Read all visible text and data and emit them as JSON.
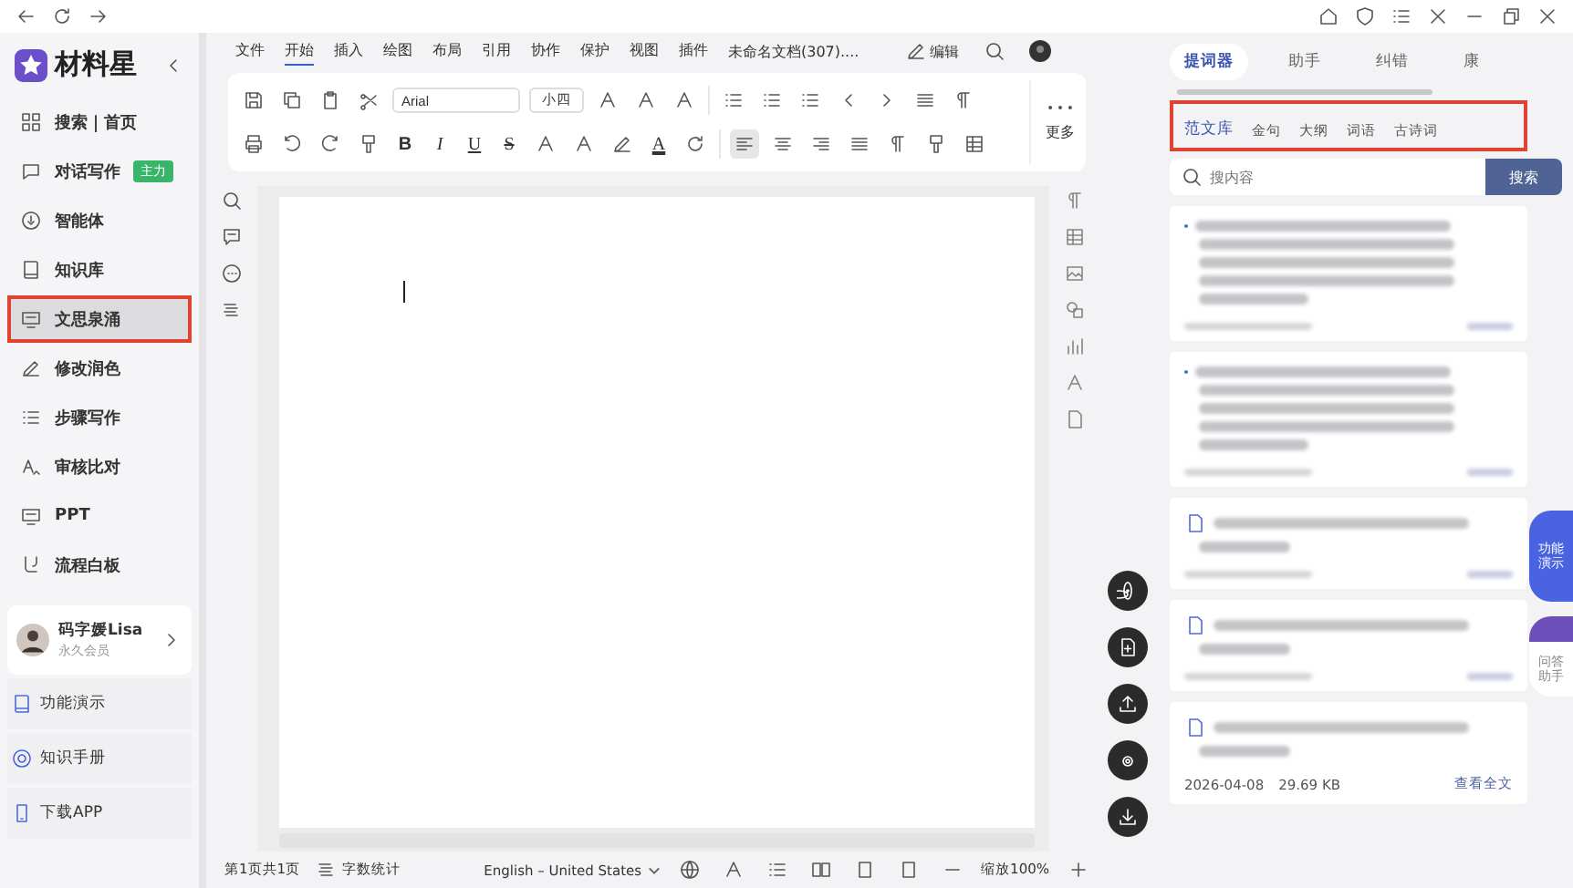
{
  "app": {
    "name": "材料星"
  },
  "sidebar": {
    "items": [
      {
        "label": "搜索｜首页",
        "selected": false,
        "highlighted": false
      },
      {
        "label": "对话写作",
        "badge": "主力",
        "selected": false,
        "highlighted": false
      },
      {
        "label": "智能体",
        "selected": false,
        "highlighted": false
      },
      {
        "label": "知识库",
        "selected": false,
        "highlighted": false
      },
      {
        "label": "文思泉涌",
        "selected": true,
        "highlighted": true
      },
      {
        "label": "修改润色",
        "selected": false,
        "highlighted": false
      },
      {
        "label": "步骤写作",
        "selected": false,
        "highlighted": false
      },
      {
        "label": "审核比对",
        "selected": false,
        "highlighted": false
      },
      {
        "label": "PPT",
        "selected": false,
        "highlighted": false
      },
      {
        "label": "流程白板",
        "selected": false,
        "highlighted": false
      }
    ],
    "user": {
      "name": "码字媛Lisa",
      "level": "永久会员"
    },
    "links": [
      {
        "label": "功能演示"
      },
      {
        "label": "知识手册"
      },
      {
        "label": "下载APP"
      }
    ]
  },
  "menu": {
    "tabs": [
      {
        "label": "文件",
        "selected": false
      },
      {
        "label": "开始",
        "selected": true
      },
      {
        "label": "插入",
        "selected": false
      },
      {
        "label": "绘图",
        "selected": false
      },
      {
        "label": "布局",
        "selected": false
      },
      {
        "label": "引用",
        "selected": false
      },
      {
        "label": "协作",
        "selected": false
      },
      {
        "label": "保护",
        "selected": false
      },
      {
        "label": "视图",
        "selected": false
      },
      {
        "label": "插件",
        "selected": false
      }
    ],
    "doc_title": "未命名文档(307)....",
    "edit": "编辑"
  },
  "toolbar": {
    "font": "Arial",
    "size": "小四",
    "format": [
      "B",
      "I",
      "U",
      "S"
    ],
    "color_letter": "A",
    "more": "更多"
  },
  "status_bar": {
    "page": "第1页共1页",
    "word_count": "字数统计",
    "language": "English – United States",
    "zoom": "缩放100%"
  },
  "panel": {
    "tabs": [
      {
        "label": "提词器",
        "selected": true
      },
      {
        "label": "助手",
        "selected": false
      },
      {
        "label": "纠错",
        "selected": false
      },
      {
        "label": "康",
        "selected": false
      }
    ],
    "subtabs_highlighted": true,
    "subtabs": [
      {
        "label": "范文库",
        "selected": true
      },
      {
        "label": "金句",
        "selected": false
      },
      {
        "label": "大纲",
        "selected": false
      },
      {
        "label": "词语",
        "selected": false
      },
      {
        "label": "古诗词",
        "selected": false
      }
    ],
    "search": {
      "placeholder": "搜内容",
      "button": "搜索"
    },
    "results": [
      {
        "kind": "bullet"
      },
      {
        "kind": "bullet"
      },
      {
        "kind": "doc"
      },
      {
        "kind": "doc"
      },
      {
        "kind": "doc",
        "date": "2026-04-08",
        "size": "29.69 KB",
        "action": "查看全文"
      }
    ],
    "floating": [
      {
        "label": "功能演示",
        "kind": "demo"
      },
      {
        "label": "问答助手",
        "kind": "assistant"
      }
    ]
  }
}
